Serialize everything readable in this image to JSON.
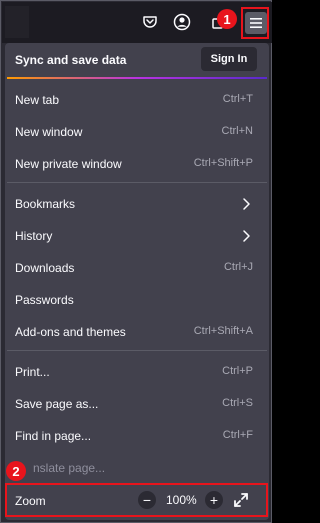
{
  "toolbar": {
    "icons": [
      "pocket-icon",
      "account-icon",
      "extensions-icon",
      "hamburger-menu-icon"
    ]
  },
  "callouts": [
    "1",
    "2"
  ],
  "panel": {
    "sync": {
      "label": "Sync and save data",
      "button": "Sign In"
    },
    "items": [
      {
        "label": "New tab",
        "shortcut": "Ctrl+T"
      },
      {
        "label": "New window",
        "shortcut": "Ctrl+N"
      },
      {
        "label": "New private window",
        "shortcut": "Ctrl+Shift+P"
      },
      {
        "label": "Bookmarks",
        "submenu": true
      },
      {
        "label": "History",
        "submenu": true
      },
      {
        "label": "Downloads",
        "shortcut": "Ctrl+J"
      },
      {
        "label": "Passwords"
      },
      {
        "label": "Add-ons and themes",
        "shortcut": "Ctrl+Shift+A"
      },
      {
        "label": "Print...",
        "shortcut": "Ctrl+P"
      },
      {
        "label": "Save page as...",
        "shortcut": "Ctrl+S"
      },
      {
        "label": "Find in page...",
        "shortcut": "Ctrl+F"
      },
      {
        "label": "Translate page...",
        "visible_text": "nslate page..."
      }
    ],
    "zoom": {
      "label": "Zoom",
      "decrease": "−",
      "value": "100%",
      "increase": "+"
    }
  },
  "colors": {
    "panel_bg": "#42414d",
    "toolbar_bg": "#1c1b22",
    "highlight_red": "#e8141c",
    "text": "#fbfbfe",
    "shortcut_text": "#a9a9b4"
  }
}
